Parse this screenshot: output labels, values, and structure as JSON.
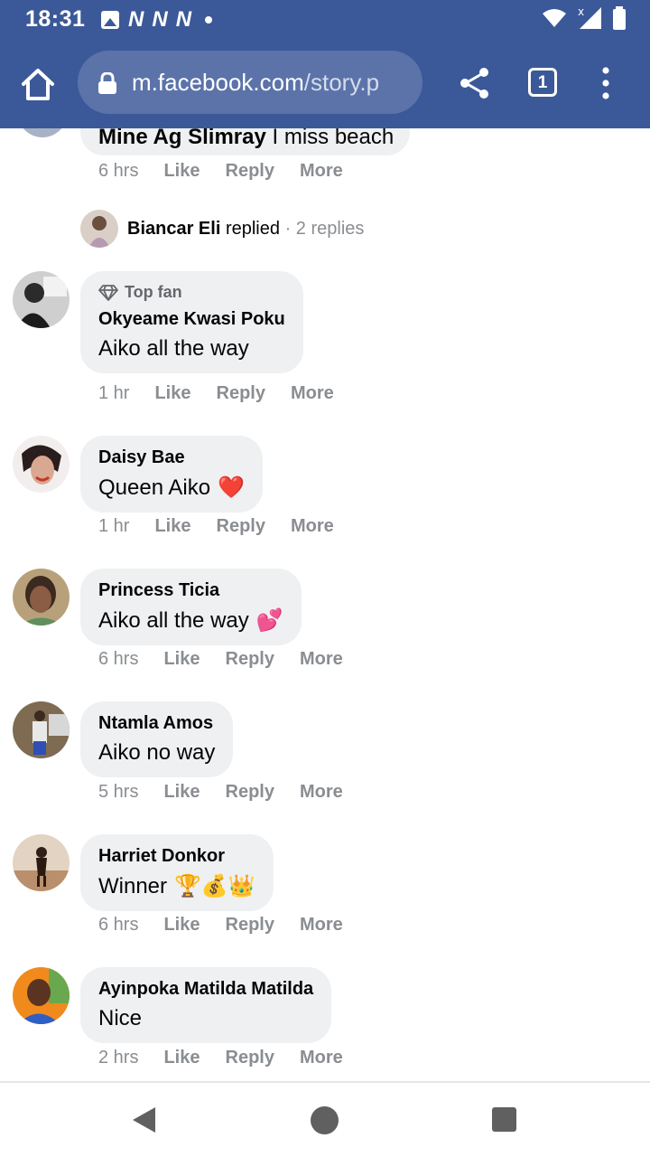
{
  "status_bar": {
    "time": "18:31",
    "notification_icons": [
      "image-icon",
      "n-icon",
      "n-icon",
      "n-icon"
    ],
    "n_glyph": "N",
    "signal_x": "x"
  },
  "browser": {
    "url_domain": "m.facebook.com",
    "url_path": "/story.p",
    "tab_count": "1"
  },
  "partial_comment": {
    "author": "Mine Ag Slimray",
    "text": "I miss beach",
    "time": "6 hrs"
  },
  "replied": {
    "name": "Biancar Eli",
    "verb": "replied",
    "separator": "·",
    "count": "2 replies"
  },
  "actions": {
    "like": "Like",
    "reply": "Reply",
    "more": "More"
  },
  "comments": [
    {
      "badge": "Top fan",
      "author": "Okyeame Kwasi Poku",
      "text": "Aiko all the way",
      "emoji": "",
      "time": "1 hr"
    },
    {
      "author": "Daisy Bae",
      "text": "Queen Aiko",
      "emoji": "❤️",
      "time": "1 hr"
    },
    {
      "author": "Princess Ticia",
      "text": "Aiko all the way",
      "emoji": "💕",
      "time": "6 hrs"
    },
    {
      "author": "Ntamla Amos",
      "text": "Aiko no way",
      "emoji": "",
      "time": "5 hrs"
    },
    {
      "author": "Harriet Donkor",
      "text": "Winner",
      "emoji": "🏆💰👑",
      "time": "6 hrs"
    },
    {
      "author": "Ayinpoka Matilda Matilda",
      "text": "Nice",
      "emoji": "",
      "time": "2 hrs"
    }
  ],
  "colors": {
    "brand": "#3b5998",
    "bubble": "#eff0f2",
    "muted_text": "#8a8d91"
  }
}
